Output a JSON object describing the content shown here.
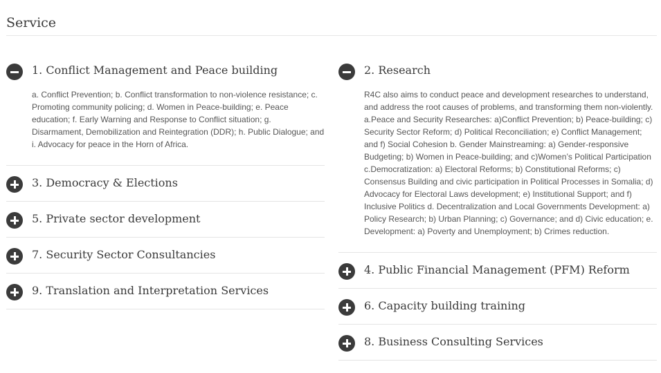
{
  "section": {
    "title": "Service"
  },
  "left": [
    {
      "title": "1. Conflict Management and Peace building",
      "expanded": true,
      "body": "a. Conflict Prevention; b. Conflict transformation to non-violence resistance; c. Promoting community policing; d. Women in Peace-building; e. Peace education; f. Early Warning and Response to Conflict situation; g. Disarmament, Demobilization and Reintegration (DDR); h. Public Dialogue; and i. Advocacy for peace in the Horn of Africa."
    },
    {
      "title": "3. Democracy & Elections",
      "expanded": false
    },
    {
      "title": "5. Private sector development",
      "expanded": false
    },
    {
      "title": "7. Security Sector Consultancies",
      "expanded": false
    },
    {
      "title": "9. Translation and Interpretation Services",
      "expanded": false
    }
  ],
  "right": [
    {
      "title": "2. Research",
      "expanded": true,
      "body": "R4C also aims to conduct peace and development researches to understand, and address the root causes of problems, and transforming them non-violently. a.Peace and Security Researches: a)Conflict Prevention; b) Peace-building; c) Security Sector Reform; d) Political Reconciliation; e) Conflict Management; and f) Social Cohesion b. Gender Mainstreaming: a) Gender-responsive Budgeting; b) Women in Peace-building; and c)Women’s Political Participation c.Democratization: a) Electoral Reforms; b) Constitutional Reforms; c) Consensus Building and civic participation in Political Processes in Somalia; d) Advocacy for Electoral Laws development; e) Institutional Support; and f) Inclusive Politics d. Decentralization and Local Governments Development: a) Policy Research; b) Urban Planning; c) Governance; and d) Civic education; e. Development: a) Poverty and Unemployment; b) Crimes reduction."
    },
    {
      "title": "4. Public Financial Management (PFM) Reform",
      "expanded": false
    },
    {
      "title": "6. Capacity building training",
      "expanded": false
    },
    {
      "title": "8. Business Consulting Services",
      "expanded": false
    }
  ]
}
